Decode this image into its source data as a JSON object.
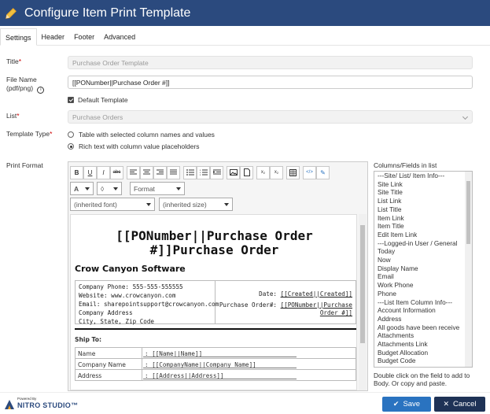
{
  "window": {
    "title": "Configure Item Print Template"
  },
  "tabs": [
    {
      "label": "Settings"
    },
    {
      "label": "Header"
    },
    {
      "label": "Footer"
    },
    {
      "label": "Advanced"
    }
  ],
  "form": {
    "title_label": "Title",
    "title_value": "Purchase Order Template",
    "filename_label_1": "File Name",
    "filename_label_2": "(pdf/png)",
    "filename_value": "[[PONumber||Purchase Order #]]",
    "default_template_label": "Default Template",
    "default_template_checked": true,
    "list_label": "List",
    "list_value": "Purchase Orders",
    "template_type_label": "Template Type",
    "template_type_options": [
      "Table with selected column names and values",
      "Rich text with column value placeholders"
    ],
    "template_type_selected": 1,
    "print_format_label": "Print Format"
  },
  "editor": {
    "toolbar_row1": [
      "B",
      "U",
      "I",
      "abc"
    ],
    "format_label": "Format",
    "font_label": "(inherited font)",
    "size_label": "(inherited size)",
    "doc": {
      "title_line1": "[[PONumber||Purchase Order",
      "title_line2": "#]]Purchase Order",
      "company": "Crow Canyon Software",
      "info_left": [
        "Company Phone: 555-555-555555",
        "Website: www.crowcanyon.com",
        "Email: sharepointsupport@crowcanyon.com",
        "Company Address",
        "City, State, Zip Code"
      ],
      "date_label": "Date:",
      "date_value": "[[Created||Created]]",
      "po_label": "Purchase Order#:",
      "po_value_1": "[[PONumber||Purchase",
      "po_value_2": "Order #]]",
      "ship_to": "Ship To:",
      "ship_rows": [
        {
          "k": "Name",
          "v": ": [[Name||Name]]"
        },
        {
          "k": "Company Name",
          "v": ": [[CompanyName||Company Name]]"
        },
        {
          "k": "Address",
          "v": ": [[Address||Address]]"
        }
      ]
    }
  },
  "columns": {
    "header": "Columns/Fields in list",
    "items": [
      "---Site/ List/ Item Info---",
      "Site Link",
      "Site Title",
      "List Link",
      "List Title",
      "Item Link",
      "Item Title",
      "Edit Item Link",
      "---Logged-in User / General",
      "Today",
      "Now",
      "Display Name",
      "Email",
      "Work Phone",
      "Phone",
      "---List Item Column Info---",
      "Account Information",
      "Address",
      "All goods have been receive",
      "Attachments",
      "Attachments Link",
      "Budget Allocation",
      "Budget Code"
    ],
    "hint": "Double click on the field to add to Body. Or copy and paste."
  },
  "footer": {
    "powered_by": "Powered By",
    "brand": "NITRO STUDIO™",
    "save_label": "Save",
    "cancel_label": "Cancel"
  },
  "colors": {
    "titlebar": "#2b4a7e",
    "save": "#2a73c0",
    "cancel": "#1e3256"
  }
}
